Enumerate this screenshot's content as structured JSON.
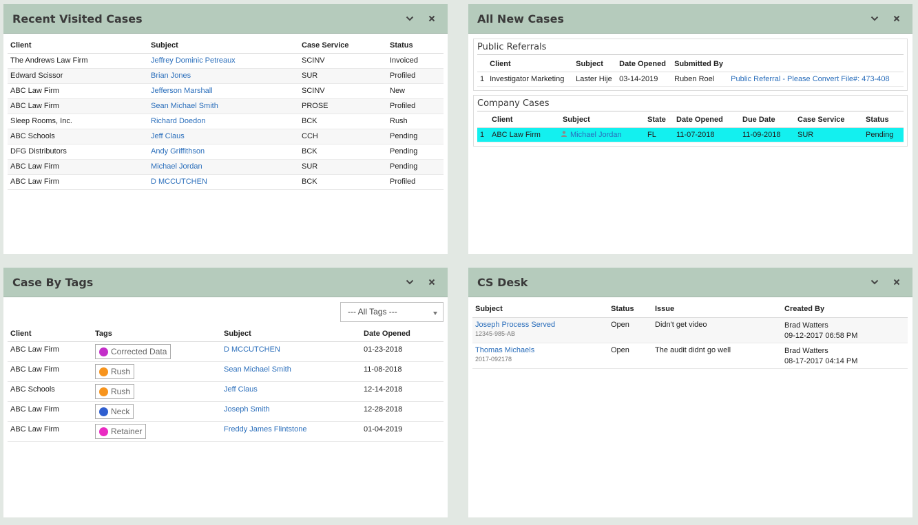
{
  "icons": {
    "collapse": "chevron-down-icon",
    "close": "close-icon",
    "user": "person-icon"
  },
  "colors": {
    "header_bg": "#b5cbbc",
    "highlight_row": "#13f0ef",
    "link": "#2a6ebb"
  },
  "recent": {
    "title": "Recent Visited Cases",
    "columns": [
      "Client",
      "Subject",
      "Case Service",
      "Status"
    ],
    "rows": [
      {
        "client": "The Andrews Law Firm",
        "subject": "Jeffrey Dominic Petreaux",
        "service": "SCINV",
        "status": "Invoiced"
      },
      {
        "client": "Edward Scissor",
        "subject": "Brian Jones",
        "service": "SUR",
        "status": "Profiled"
      },
      {
        "client": "ABC Law Firm",
        "subject": "Jefferson Marshall",
        "service": "SCINV",
        "status": "New"
      },
      {
        "client": "ABC Law Firm",
        "subject": "Sean Michael Smith",
        "service": "PROSE",
        "status": "Profiled"
      },
      {
        "client": "Sleep Rooms, Inc.",
        "subject": "Richard Doedon",
        "service": "BCK",
        "status": "Rush"
      },
      {
        "client": "ABC Schools",
        "subject": "Jeff Claus",
        "service": "CCH",
        "status": "Pending"
      },
      {
        "client": "DFG Distributors",
        "subject": "Andy Griffithson",
        "service": "BCK",
        "status": "Pending"
      },
      {
        "client": "ABC Law Firm",
        "subject": "Michael Jordan",
        "service": "SUR",
        "status": "Pending"
      },
      {
        "client": "ABC Law Firm",
        "subject": "D MCCUTCHEN",
        "service": "BCK",
        "status": "Profiled"
      }
    ]
  },
  "newcases": {
    "title": "All New Cases",
    "referrals": {
      "title": "Public Referrals",
      "columns": [
        "Client",
        "Subject",
        "Date Opened",
        "Submitted By"
      ],
      "rows": [
        {
          "num": "1",
          "client": "Investigator Marketing",
          "subject": "Laster Hije",
          "date": "03-14-2019",
          "by": "Ruben Roel",
          "link": "Public Referral - Please Convert File#: 473-408"
        }
      ]
    },
    "company": {
      "title": "Company Cases",
      "columns": [
        "Client",
        "Subject",
        "State",
        "Date Opened",
        "Due Date",
        "Case Service",
        "Status"
      ],
      "rows": [
        {
          "num": "1",
          "client": "ABC Law Firm",
          "subject": "Michael Jordan",
          "state": "FL",
          "opened": "11-07-2018",
          "due": "11-09-2018",
          "service": "SUR",
          "status": "Pending"
        }
      ]
    }
  },
  "tags": {
    "title": "Case By Tags",
    "filter": "--- All Tags ---",
    "columns": [
      "Client",
      "Tags",
      "Subject",
      "Date Opened"
    ],
    "rows": [
      {
        "client": "ABC Law Firm",
        "tag": "Corrected Data",
        "color": "#c42fc9",
        "subject": "D MCCUTCHEN",
        "date": "01-23-2018"
      },
      {
        "client": "ABC Law Firm",
        "tag": "Rush",
        "color": "#f7941d",
        "subject": "Sean Michael Smith",
        "date": "11-08-2018"
      },
      {
        "client": "ABC Schools",
        "tag": "Rush",
        "color": "#f7941d",
        "subject": "Jeff Claus",
        "date": "12-14-2018"
      },
      {
        "client": "ABC Law Firm",
        "tag": "Neck",
        "color": "#2f5fd0",
        "subject": "Joseph Smith",
        "date": "12-28-2018"
      },
      {
        "client": "ABC Law Firm",
        "tag": "Retainer",
        "color": "#ea2bc2",
        "subject": "Freddy James Flintstone",
        "date": "01-04-2019"
      }
    ]
  },
  "csdesk": {
    "title": "CS Desk",
    "columns": [
      "Subject",
      "Status",
      "Issue",
      "Created By"
    ],
    "rows": [
      {
        "subject": "Joseph Process Served",
        "ref": "12345-985-AB",
        "status": "Open",
        "issue": "Didn't get video",
        "by": "Brad Watters",
        "date": "09-12-2017 06:58 PM"
      },
      {
        "subject": "Thomas Michaels",
        "ref": "2017-092178",
        "status": "Open",
        "issue": "The audit didnt go well",
        "by": "Brad Watters",
        "date": "08-17-2017 04:14 PM"
      }
    ]
  }
}
